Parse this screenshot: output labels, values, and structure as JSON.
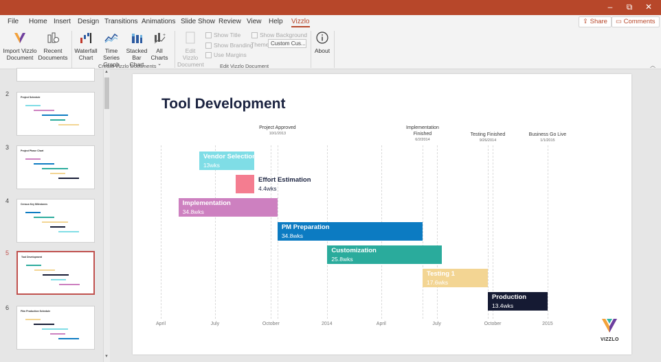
{
  "app": {
    "title_bar_color": "#b7472a",
    "accent": "#b7472a"
  },
  "window_controls": [
    "–",
    "⧉",
    "✕"
  ],
  "menu": {
    "tabs": [
      "File",
      "Home",
      "Insert",
      "Design",
      "Transitions",
      "Animations",
      "Slide Show",
      "Review",
      "View",
      "Help",
      "Vizzlo"
    ],
    "active": "Vizzlo",
    "share": "Share",
    "comments": "Comments"
  },
  "ribbon": {
    "import": "Import Vizzlo Document",
    "recent": "Recent Documents",
    "waterfall": "Waterfall Chart",
    "timeseries": "Time Series Graph",
    "stacked": "Stacked Bar Chart",
    "allcharts": "All Charts",
    "group1": "Create Vizzlo Documents",
    "edit": "Edit Vizzlo Document",
    "show_title": "Show Title",
    "show_branding": "Show Branding",
    "use_margins": "Use Margins",
    "show_background": "Show Background",
    "theme_label": "Theme",
    "theme_value": "Custom Cus...",
    "about": "About",
    "group2": "Edit Vizzlo Document"
  },
  "thumbnails": [
    {
      "num": "2",
      "title": "Project Schedule"
    },
    {
      "num": "3",
      "title": "Project Phase Chart"
    },
    {
      "num": "4",
      "title": "Census Key Milestones"
    },
    {
      "num": "5",
      "title": "Tool Development",
      "selected": true
    },
    {
      "num": "6",
      "title": "Film Production Schedule"
    }
  ],
  "slide": {
    "title": "Tool Development",
    "milestones": [
      {
        "name": "Project Approved",
        "date": "10/1/2013",
        "x": 0.2775
      },
      {
        "name": "Implementation Finished",
        "date": "6/2/2014",
        "x": 0.6225
      },
      {
        "name": "Testing Finished",
        "date": "9/26/2014",
        "x": 0.7777
      },
      {
        "name": "Business Go Live",
        "date": "1/1/2015",
        "x": 0.9198
      }
    ],
    "tasks": [
      {
        "name": "Vendor Selection",
        "duration": "13wks",
        "color": "#7fdde6",
        "start": 0.0912,
        "end": 0.2222,
        "label": "inside"
      },
      {
        "name": "Effort Estimation",
        "duration": "4.4wks",
        "color": "#f47d90",
        "start": 0.1781,
        "end": 0.2222,
        "label": "outside"
      },
      {
        "name": "Implementation",
        "duration": "34.8wks",
        "color": "#cd80c0",
        "start": 0.0419,
        "end": 0.2775,
        "label": "inside"
      },
      {
        "name": "PM Preparation",
        "duration": "34.8wks",
        "color": "#0c7bc2",
        "start": 0.2775,
        "end": 0.6225,
        "label": "inside"
      },
      {
        "name": "Customization",
        "duration": "25.8wks",
        "color": "#2aab9c",
        "start": 0.3961,
        "end": 0.6678,
        "label": "inside"
      },
      {
        "name": "Testing 1",
        "duration": "17.6wks",
        "color": "#f3d593",
        "start": 0.6225,
        "end": 0.7777,
        "label": "inside"
      },
      {
        "name": "Production",
        "duration": "13.4wks",
        "color": "#151a33",
        "start": 0.7777,
        "end": 0.9198,
        "label": "inside"
      }
    ],
    "axis": [
      {
        "label": "April",
        "x": 0.0
      },
      {
        "label": "July",
        "x": 0.1289
      },
      {
        "label": "October",
        "x": 0.262
      },
      {
        "label": "2014",
        "x": 0.3951
      },
      {
        "label": "April",
        "x": 0.5242
      },
      {
        "label": "July",
        "x": 0.6563
      },
      {
        "label": "October",
        "x": 0.7893
      },
      {
        "label": "2015",
        "x": 0.9198
      }
    ],
    "logo": "VIZZLO"
  }
}
